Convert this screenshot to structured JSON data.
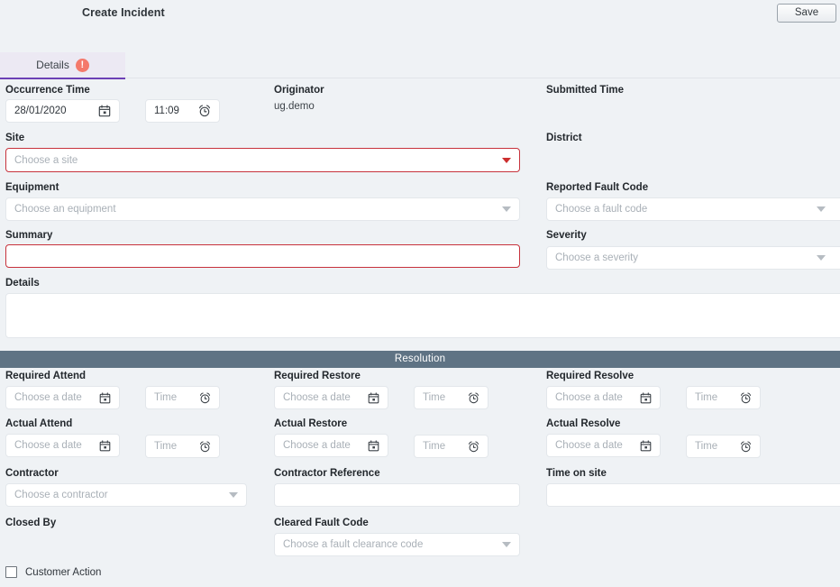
{
  "header": {
    "title": "Create Incident",
    "save_label": "Save"
  },
  "tabs": [
    {
      "label": "Details",
      "badge": "!",
      "badge_color": "#f4796b",
      "active": true
    }
  ],
  "details_section": {
    "occurrence_time": {
      "label": "Occurrence Time",
      "date_value": "28/01/2020",
      "date_icon": "calendar-icon",
      "time_value": "11:09",
      "time_icon": "alarm-clock-icon"
    },
    "originator": {
      "label": "Originator",
      "value": "ug.demo"
    },
    "submitted_time": {
      "label": "Submitted Time",
      "value": ""
    },
    "site": {
      "label": "Site",
      "placeholder": "Choose a site",
      "required": true,
      "error_color": "#c7323c"
    },
    "district": {
      "label": "District",
      "value": ""
    },
    "equipment": {
      "label": "Equipment",
      "placeholder": "Choose an equipment"
    },
    "reported_fault_code": {
      "label": "Reported Fault Code",
      "placeholder": "Choose a fault code"
    },
    "summary": {
      "label": "Summary",
      "value": "",
      "required": true
    },
    "severity": {
      "label": "Severity",
      "placeholder": "Choose a severity"
    },
    "details": {
      "label": "Details",
      "value": ""
    }
  },
  "resolution_section": {
    "header": "Resolution",
    "header_bg": "#5f7384",
    "required_attend": {
      "label": "Required Attend",
      "date_placeholder": "Choose a date",
      "time_placeholder": "Time"
    },
    "required_restore": {
      "label": "Required Restore",
      "date_placeholder": "Choose a date",
      "time_placeholder": "Time"
    },
    "required_resolve": {
      "label": "Required Resolve",
      "date_placeholder": "Choose a date",
      "time_placeholder": "Time"
    },
    "actual_attend": {
      "label": "Actual Attend",
      "date_placeholder": "Choose a date",
      "time_placeholder": "Time"
    },
    "actual_restore": {
      "label": "Actual Restore",
      "date_placeholder": "Choose a date",
      "time_placeholder": "Time"
    },
    "actual_resolve": {
      "label": "Actual Resolve",
      "date_placeholder": "Choose a date",
      "time_placeholder": "Time"
    },
    "contractor": {
      "label": "Contractor",
      "placeholder": "Choose a contractor"
    },
    "contractor_reference": {
      "label": "Contractor Reference",
      "value": ""
    },
    "time_on_site": {
      "label": "Time on site",
      "value": ""
    },
    "closed_by": {
      "label": "Closed By",
      "value": ""
    },
    "cleared_fault_code": {
      "label": "Cleared Fault Code",
      "placeholder": "Choose a fault clearance code"
    },
    "customer_action": {
      "label": "Customer Action",
      "checked": false
    }
  }
}
